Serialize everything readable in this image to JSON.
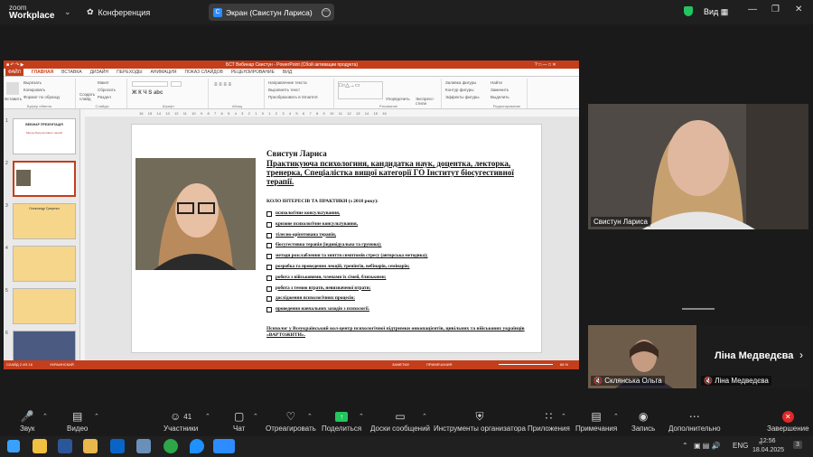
{
  "app": {
    "logo_line1": "zoom",
    "logo_line2": "Workplace",
    "conference_label": "Конференция",
    "share_label": "Экран (Свистун Лариса)",
    "view_label": "Вид"
  },
  "ppt": {
    "window_title": "БСТ Вебинар Свистун - PowerPoint (Сбой активации продукта)",
    "menu": [
      "ФАЙЛ",
      "ГЛАВНАЯ",
      "ВСТАВКА",
      "ДИЗАЙН",
      "ПЕРЕХОДЫ",
      "АНИМАЦИЯ",
      "ПОКАЗ СЛАЙДОВ",
      "РЕЦЕНЗИРОВАНИЕ",
      "ВИД"
    ],
    "ribbon": {
      "paste": "Вставить",
      "cut": "Вырезать",
      "copy": "Копировать",
      "format_painter": "Формат по образцу",
      "clipboard": "Буфер обмена",
      "create_slide": "Создать слайд",
      "layout": "Макет",
      "reset": "Сбросить",
      "section": "Раздел",
      "slides": "Слайды",
      "font": "Шрифт",
      "paragraph": "Абзац",
      "text_direction": "Направление текста",
      "align_text": "Выровнять текст",
      "smartart": "Преобразовать в SmartArt",
      "arrange": "Упорядочить",
      "express_styles": "Экспресс-стили",
      "fill": "Заливка фигуры",
      "outline": "Контур фигуры",
      "effects": "Эффекты фигуры",
      "drawing": "Рисование",
      "find": "Найти",
      "replace": "Заменить",
      "select": "Выделить",
      "editing": "Редактирование"
    },
    "thumb_numbers": [
      "1",
      "2",
      "3",
      "4",
      "5",
      "6"
    ],
    "thumb1_title": "ВЕБІНАР ПРЕЗЕНТАЦІЯ",
    "thumb1_sub": "Метод біосугестивної терапії",
    "thumb3_title": "Олександр Гриценко",
    "ruler_numbers": [
      "16",
      "15",
      "14",
      "13",
      "12",
      "11",
      "10",
      "9",
      "8",
      "7",
      "6",
      "5",
      "4",
      "3",
      "2",
      "1",
      "0",
      "1",
      "2",
      "3",
      "4",
      "5",
      "6",
      "7",
      "8",
      "9",
      "10",
      "11",
      "12",
      "13",
      "14",
      "15",
      "16"
    ],
    "status": {
      "slide": "СЛАЙД 2 ИЗ 16",
      "lang": "УКРАИНСКИЙ",
      "notes": "ЗАМЕТКИ",
      "comments": "ПРИМЕЧАНИЯ",
      "zoom": "66 %"
    },
    "slide": {
      "name": "Свистун Лариса",
      "title": "Практикуюча психологиня, кандидатка наук, доцентка, лекторка, тренерка, Спеціалістка вищої категорії ГО Інститут біосугестивної терапії.",
      "kolo_heading": "КОЛО ІНТЕРЕСІВ ТА ПРАКТИКИ (з 2018 року):",
      "items": [
        "психологічне консультування,",
        "кризове психологічне консультування,",
        "тілесно-орієнтована терапія,",
        "біосугестивна терапія (індивідуальна та групова);",
        "методи розслаблення та зняття симптомів стресу (авторська методика);",
        "розробка та проведення лекцій, тренінгів, вебінарів, семінарів;",
        "робота з військовими, членами їх сімей, близькими;",
        "робота з темою втрати, невизначеної втрати;",
        "дослідження психологічних процесів;",
        "проведення навчальних заходів з психології."
      ],
      "footer": "Психолог у Всеукраїнський кол-центр психологічної підтримки онкопацієнтів, цивільних та військових українців «ВАРТОЖИТИ»."
    }
  },
  "participants": [
    {
      "name": "Свистун Лариса"
    },
    {
      "name": "Склянська Ольга"
    },
    {
      "name": "Ліна Медведєва",
      "big_label": "Ліна Медведєва"
    }
  ],
  "toolbar": [
    {
      "label": "Звук",
      "icon": "mic-muted-icon"
    },
    {
      "label": "Видео",
      "icon": "video-icon"
    },
    {
      "label": "Участники",
      "icon": "participants-icon",
      "count": "41"
    },
    {
      "label": "Чат",
      "icon": "chat-icon"
    },
    {
      "label": "Отреагировать",
      "icon": "heart-icon"
    },
    {
      "label": "Поделиться",
      "icon": "share-icon"
    },
    {
      "label": "Доски сообщений",
      "icon": "whiteboard-icon"
    },
    {
      "label": "Инструменты организатора",
      "icon": "shield-icon"
    },
    {
      "label": "Приложения",
      "icon": "apps-icon"
    },
    {
      "label": "Примечания",
      "icon": "notes-icon"
    },
    {
      "label": "Запись",
      "icon": "record-icon"
    },
    {
      "label": "Дополнительно",
      "icon": "more-icon"
    },
    {
      "label": "Завершение",
      "icon": "end-icon"
    }
  ],
  "taskbar": {
    "lang": "ENG",
    "time": "12:56",
    "date": "18.04.2025",
    "notif": "3"
  },
  "colors": {
    "ppt_accent": "#c43e1c",
    "zoom_blue": "#2d8cff",
    "share_green": "#22c55e",
    "end_red": "#e02828"
  }
}
